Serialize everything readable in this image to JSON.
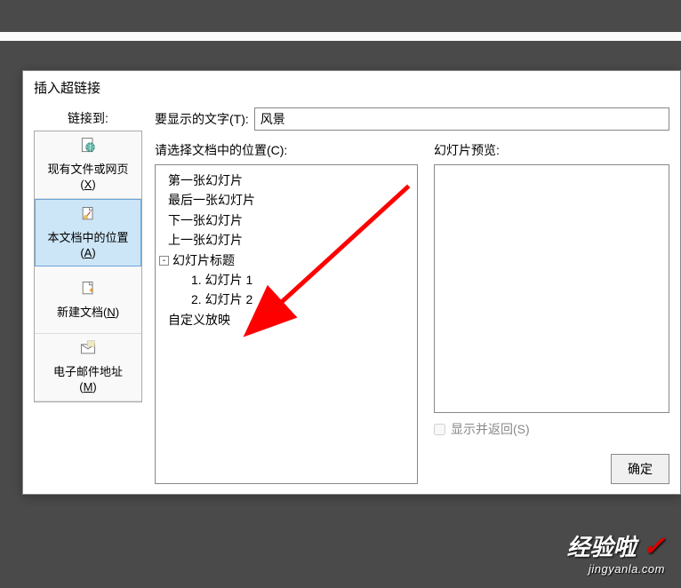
{
  "dialog": {
    "title": "插入超链接"
  },
  "sidebar": {
    "label": "链接到:",
    "items": [
      {
        "label": "现有文件或网页",
        "key": "X"
      },
      {
        "label": "本文档中的位置",
        "key": "A"
      },
      {
        "label": "新建文档",
        "key": "N"
      },
      {
        "label": "电子邮件地址",
        "key": "M"
      }
    ]
  },
  "textToDisplay": {
    "label": "要显示的文字(T):",
    "value": "风景"
  },
  "locationSection": {
    "label": "请选择文档中的位置(C):",
    "tree": {
      "item1": "第一张幻灯片",
      "item2": "最后一张幻灯片",
      "item3": "下一张幻灯片",
      "item4": "上一张幻灯片",
      "groupTitle": "幻灯片标题",
      "slide1": "1. 幻灯片 1",
      "slide2": "2. 幻灯片 2",
      "item5": "自定义放映"
    }
  },
  "previewSection": {
    "label": "幻灯片预览:"
  },
  "checkbox": {
    "label": "显示并返回(S)"
  },
  "buttons": {
    "ok": "确定"
  },
  "watermark": {
    "brand": "经验啦",
    "url": "jingyanla.com"
  }
}
